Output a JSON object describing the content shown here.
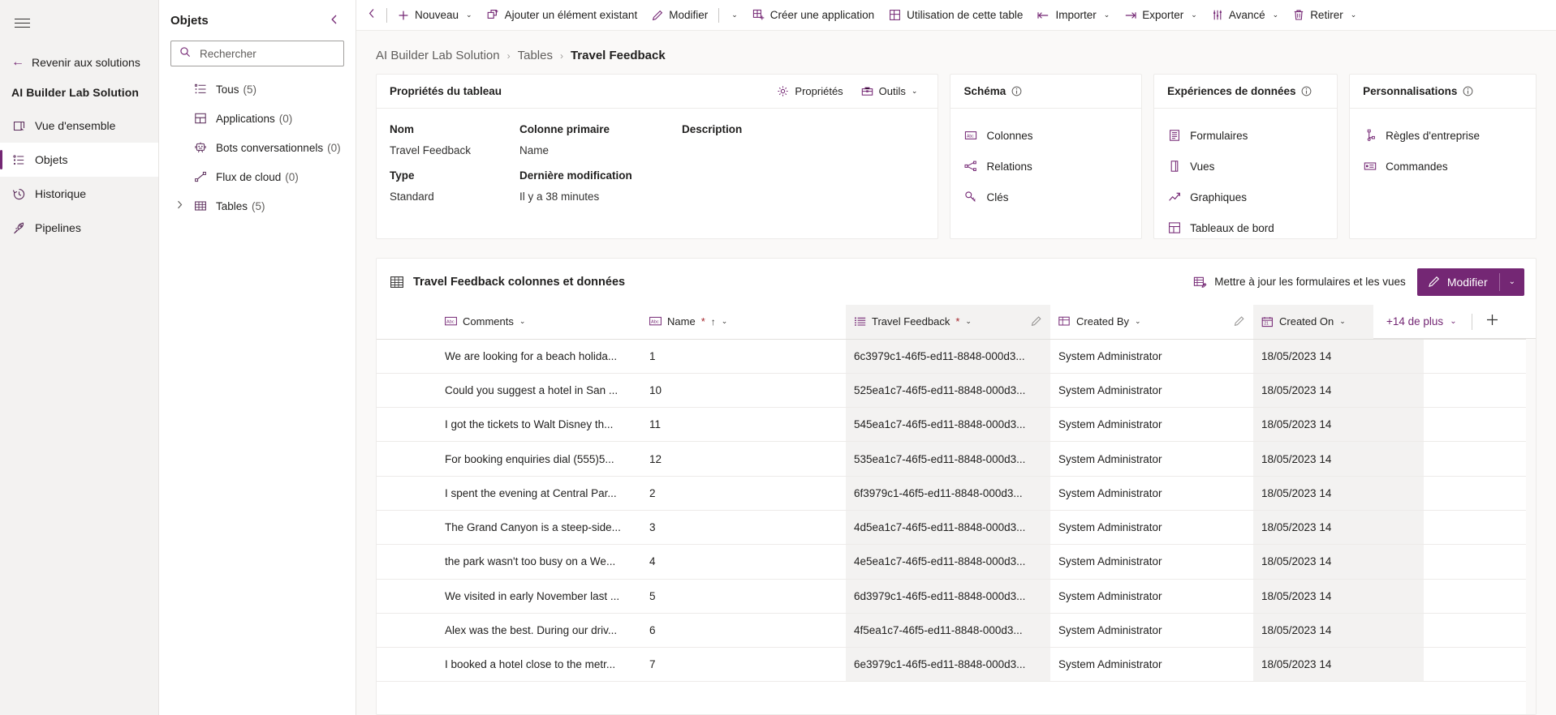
{
  "rail": {
    "menu_icon": "hamburger-icon",
    "back_label": "Revenir aux solutions",
    "solution_title": "AI Builder Lab Solution",
    "items": [
      {
        "label": "Vue d'ensemble",
        "icon": "overview-icon",
        "selected": false
      },
      {
        "label": "Objets",
        "icon": "objects-icon",
        "selected": true
      },
      {
        "label": "Historique",
        "icon": "history-icon",
        "selected": false
      },
      {
        "label": "Pipelines",
        "icon": "rocket-icon",
        "selected": false
      }
    ]
  },
  "objects_panel": {
    "title": "Objets",
    "collapse_icon": "chevron-left-icon",
    "search": {
      "placeholder": "Rechercher",
      "value": "",
      "icon": "search-icon"
    },
    "tree": [
      {
        "label": "Tous",
        "count": "(5)",
        "icon": "list-icon",
        "expandable": false
      },
      {
        "label": "Applications",
        "count": "(0)",
        "icon": "apps-icon",
        "expandable": false
      },
      {
        "label": "Bots conversationnels",
        "count": "(0)",
        "icon": "bot-icon",
        "expandable": false
      },
      {
        "label": "Flux de cloud",
        "count": "(0)",
        "icon": "flow-icon",
        "expandable": false
      },
      {
        "label": "Tables",
        "count": "(5)",
        "icon": "table-icon",
        "expandable": true
      }
    ]
  },
  "commandbar": {
    "collapse_icon": "chevron-left-icon",
    "items": [
      {
        "label": "Nouveau",
        "icon": "plus-icon",
        "caret": true
      },
      {
        "label": "Ajouter un élément existant",
        "icon": "add-existing-icon",
        "caret": false
      },
      {
        "label": "Modifier",
        "icon": "pencil-icon",
        "caret": true,
        "separator_before_caret": true
      },
      {
        "label": "Créer une application",
        "icon": "app-grid-icon",
        "caret": false
      },
      {
        "label": "Utilisation de cette table",
        "icon": "app-grid-icon",
        "caret": false
      },
      {
        "label": "Importer",
        "icon": "import-arrow-icon",
        "caret": true
      },
      {
        "label": "Exporter",
        "icon": "export-arrow-icon",
        "caret": true
      },
      {
        "label": "Avancé",
        "icon": "sliders-icon",
        "caret": true
      },
      {
        "label": "Retirer",
        "icon": "trash-icon",
        "caret": true
      }
    ]
  },
  "breadcrumb": {
    "items": [
      "AI Builder Lab Solution",
      "Tables"
    ],
    "current": "Travel Feedback",
    "separator": "›"
  },
  "table_properties": {
    "title": "Propriétés du tableau",
    "actions": [
      {
        "label": "Propriétés",
        "icon": "gear-icon",
        "caret": false
      },
      {
        "label": "Outils",
        "icon": "toolbox-icon",
        "caret": true
      }
    ],
    "fields": [
      {
        "header": "Nom",
        "value": "Travel Feedback"
      },
      {
        "header": "Colonne primaire",
        "value": "Name"
      },
      {
        "header": "Description",
        "value": ""
      },
      {
        "header": "Type",
        "value": "Standard"
      },
      {
        "header": "Dernière modification",
        "value": "Il y a 38 minutes"
      },
      {
        "header": "",
        "value": ""
      }
    ]
  },
  "schema_card": {
    "title": "Schéma",
    "info_icon": "info-icon",
    "links": [
      {
        "label": "Colonnes",
        "icon": "columns-icon"
      },
      {
        "label": "Relations",
        "icon": "relations-icon"
      },
      {
        "label": "Clés",
        "icon": "key-icon"
      }
    ]
  },
  "data_experiences_card": {
    "title": "Expériences de données",
    "info_icon": "info-icon",
    "links": [
      {
        "label": "Formulaires",
        "icon": "form-icon"
      },
      {
        "label": "Vues",
        "icon": "view-icon"
      },
      {
        "label": "Graphiques",
        "icon": "chart-icon"
      },
      {
        "label": "Tableaux de bord",
        "icon": "dashboard-icon"
      }
    ]
  },
  "customizations_card": {
    "title": "Personnalisations",
    "info_icon": "info-icon",
    "links": [
      {
        "label": "Règles d'entreprise",
        "icon": "business-rules-icon"
      },
      {
        "label": "Commandes",
        "icon": "commands-icon"
      }
    ]
  },
  "grid_card": {
    "title": "Travel Feedback colonnes et données",
    "title_icon": "table-icon",
    "update_button": {
      "label": "Mettre à jour les formulaires et les vues",
      "icon": "update-forms-icon"
    },
    "edit_button": {
      "label": "Modifier",
      "icon": "pencil-icon",
      "caret": "⌄"
    },
    "more_columns": {
      "label": "+14 de plus",
      "caret": "⌄",
      "add_icon": "plus-icon"
    },
    "columns": [
      {
        "key": "sel",
        "label": "",
        "icon": "",
        "required": false,
        "sorted": false,
        "shaded": false
      },
      {
        "key": "comments",
        "label": "Comments",
        "icon": "abc-icon",
        "required": false,
        "sorted": false,
        "shaded": false
      },
      {
        "key": "name",
        "label": "Name",
        "icon": "abc-icon",
        "required": true,
        "sorted": true,
        "sort_dir": "↑",
        "shaded": false
      },
      {
        "key": "travel_feedback",
        "label": "Travel Feedback",
        "icon": "choices-icon",
        "required": true,
        "sorted": false,
        "shaded": true,
        "edit_icon": "edit-pen-icon"
      },
      {
        "key": "created_by",
        "label": "Created By",
        "icon": "lookup-icon",
        "required": false,
        "sorted": false,
        "shaded": false,
        "edit_icon": "edit-pen-icon"
      },
      {
        "key": "created_on",
        "label": "Created On",
        "icon": "calendar-icon",
        "required": false,
        "sorted": false,
        "shaded": true
      }
    ],
    "rows": [
      {
        "comments": "We are looking for a beach holida...",
        "name": "1",
        "travel_feedback": "6c3979c1-46f5-ed11-8848-000d3...",
        "created_by": "System Administrator",
        "created_on": "18/05/2023 14"
      },
      {
        "comments": "Could you suggest a hotel in San ...",
        "name": "10",
        "travel_feedback": "525ea1c7-46f5-ed11-8848-000d3...",
        "created_by": "System Administrator",
        "created_on": "18/05/2023 14"
      },
      {
        "comments": "I got the tickets to Walt Disney th...",
        "name": "11",
        "travel_feedback": "545ea1c7-46f5-ed11-8848-000d3...",
        "created_by": "System Administrator",
        "created_on": "18/05/2023 14"
      },
      {
        "comments": "For booking enquiries dial (555)5...",
        "name": "12",
        "travel_feedback": "535ea1c7-46f5-ed11-8848-000d3...",
        "created_by": "System Administrator",
        "created_on": "18/05/2023 14"
      },
      {
        "comments": "I spent the evening at Central Par...",
        "name": "2",
        "travel_feedback": "6f3979c1-46f5-ed11-8848-000d3...",
        "created_by": "System Administrator",
        "created_on": "18/05/2023 14"
      },
      {
        "comments": "The Grand Canyon is a steep-side...",
        "name": "3",
        "travel_feedback": "4d5ea1c7-46f5-ed11-8848-000d3...",
        "created_by": "System Administrator",
        "created_on": "18/05/2023 14"
      },
      {
        "comments": "the park wasn't too busy on a We...",
        "name": "4",
        "travel_feedback": "4e5ea1c7-46f5-ed11-8848-000d3...",
        "created_by": "System Administrator",
        "created_on": "18/05/2023 14"
      },
      {
        "comments": "We visited in early November last ...",
        "name": "5",
        "travel_feedback": "6d3979c1-46f5-ed11-8848-000d3...",
        "created_by": "System Administrator",
        "created_on": "18/05/2023 14"
      },
      {
        "comments": "Alex was the best. During our driv...",
        "name": "6",
        "travel_feedback": "4f5ea1c7-46f5-ed11-8848-000d3...",
        "created_by": "System Administrator",
        "created_on": "18/05/2023 14"
      },
      {
        "comments": "I booked a hotel close to the metr...",
        "name": "7",
        "travel_feedback": "6e3979c1-46f5-ed11-8848-000d3...",
        "created_by": "System Administrator",
        "created_on": "18/05/2023 14"
      }
    ]
  },
  "colors": {
    "accent": "#742774",
    "rail_bg": "#f3f2f1",
    "canvas_bg": "#faf9f8",
    "required_mark": "#a4262c"
  }
}
